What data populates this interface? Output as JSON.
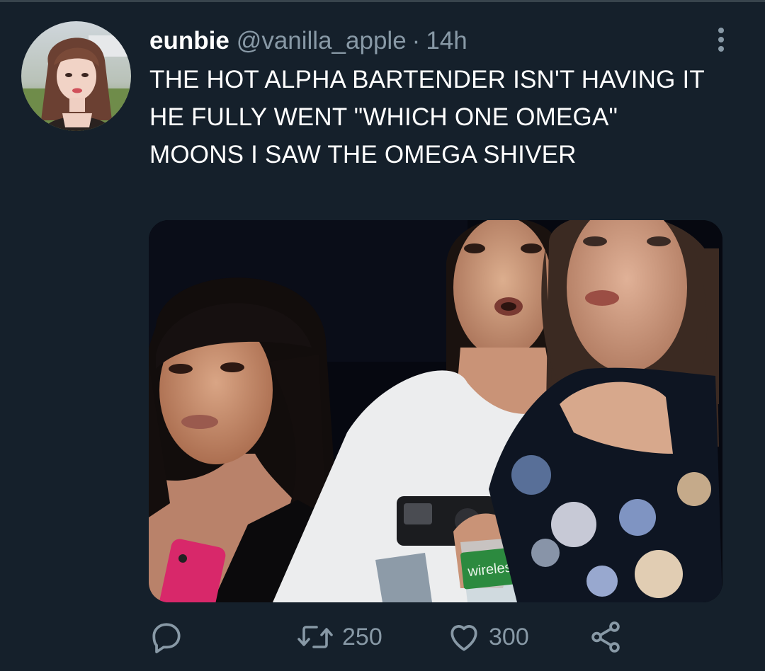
{
  "tweet": {
    "display_name": "eunbie",
    "handle": "@vanilla_apple",
    "separator": "·",
    "time": "14h",
    "text": "THE HOT ALPHA BARTENDER ISN'T HAVING IT HE FULLY WENT \"WHICH ONE OMEGA\" MOONS I SAW THE OMEGA SHIVER",
    "avatar_icon": "profile-photo",
    "more_icon": "more-vertical-icon"
  },
  "media": {
    "kind": "photo",
    "visible_text": "wireless"
  },
  "actions": {
    "reply_icon": "reply-icon",
    "retweet_icon": "retweet-icon",
    "retweet_count": "250",
    "like_icon": "heart-icon",
    "like_count": "300",
    "share_icon": "share-icon"
  },
  "colors": {
    "background": "#15202b",
    "primary_text": "#ffffff",
    "secondary_text": "#8899a6"
  }
}
